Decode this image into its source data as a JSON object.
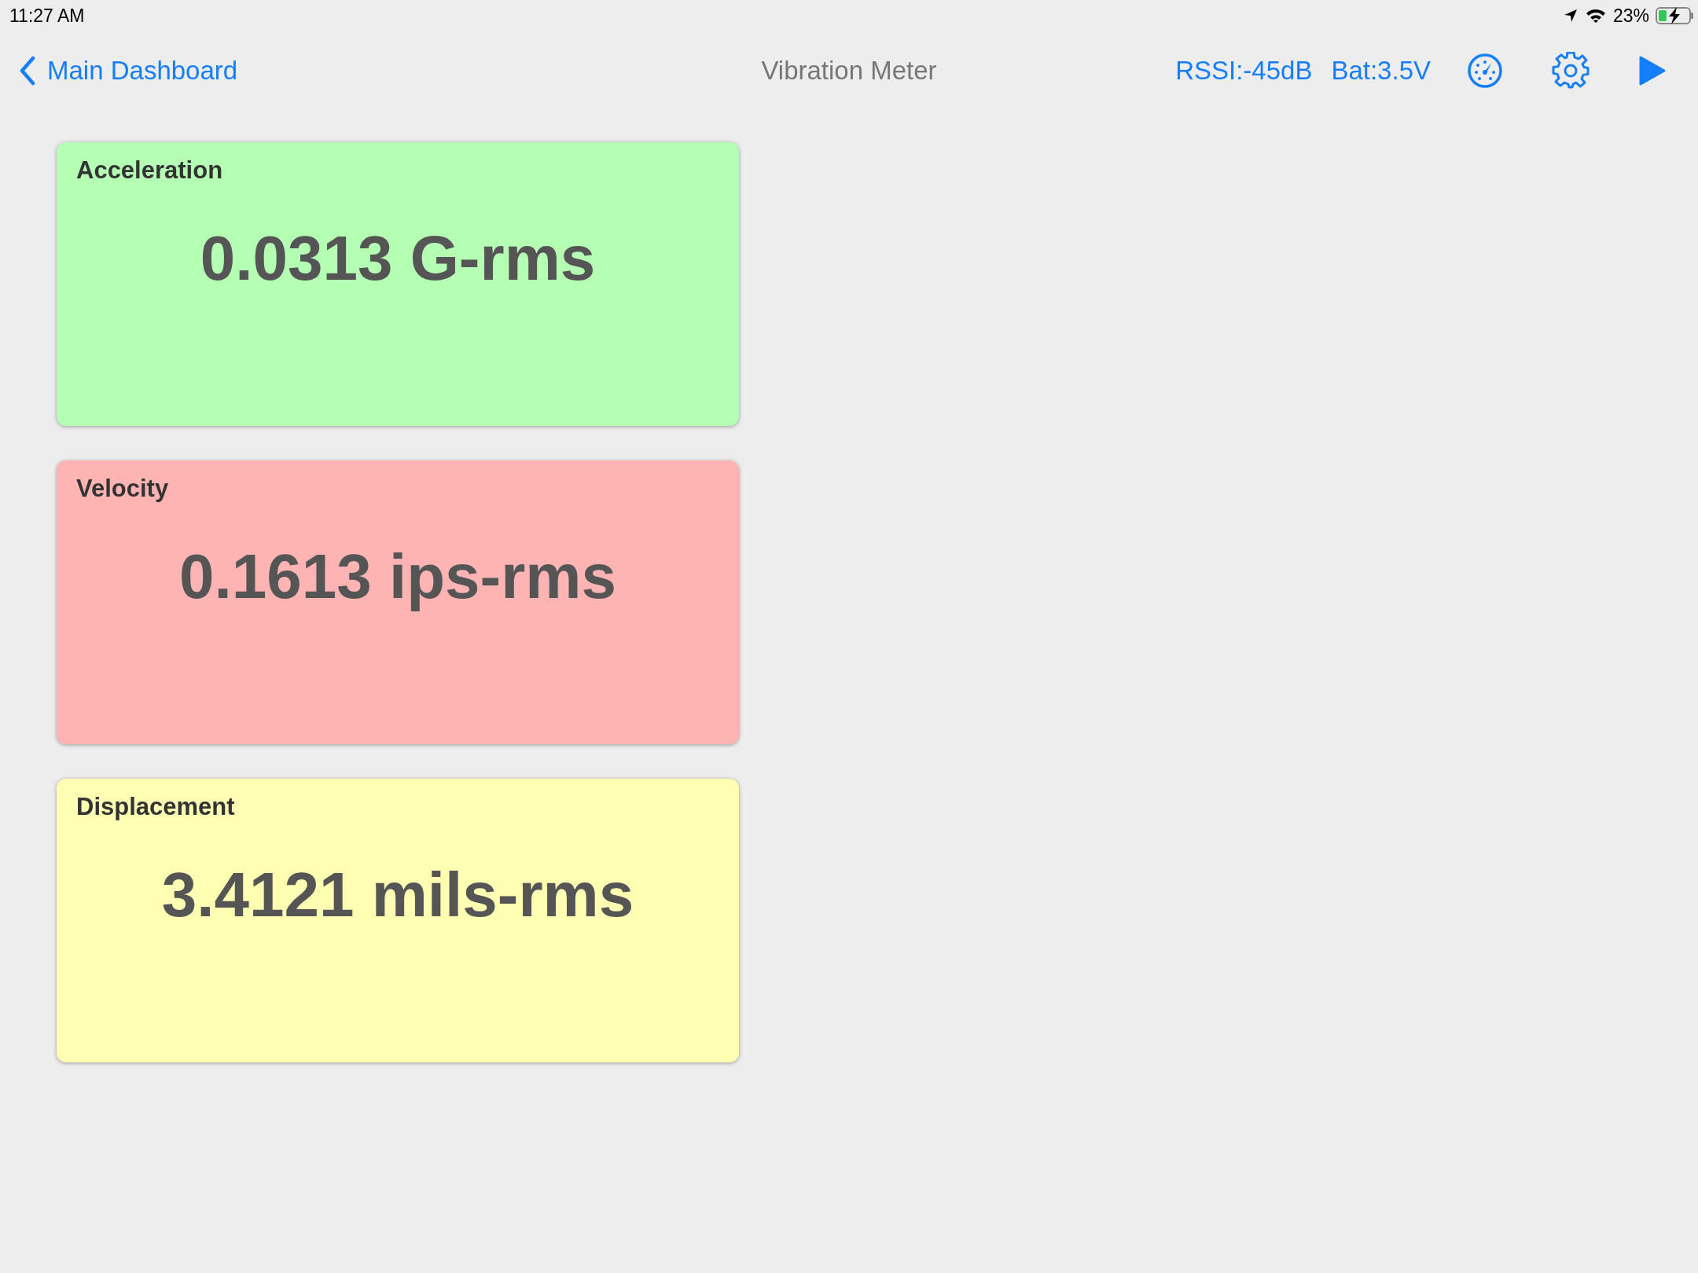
{
  "status_bar": {
    "time": "11:27 AM",
    "battery_percent": "23%"
  },
  "nav_bar": {
    "back_label": "Main Dashboard",
    "title": "Vibration Meter",
    "rssi": "RSSI:-45dB",
    "battery_voltage": "Bat:3.5V"
  },
  "cards": [
    {
      "title": "Acceleration",
      "value": "0.0313 G-rms",
      "color": "#b4ffb4"
    },
    {
      "title": "Velocity",
      "value": "0.1613 ips-rms",
      "color": "#ffb4b4"
    },
    {
      "title": "Displacement",
      "value": "3.4121 mils-rms",
      "color": "#ffffb4"
    }
  ]
}
